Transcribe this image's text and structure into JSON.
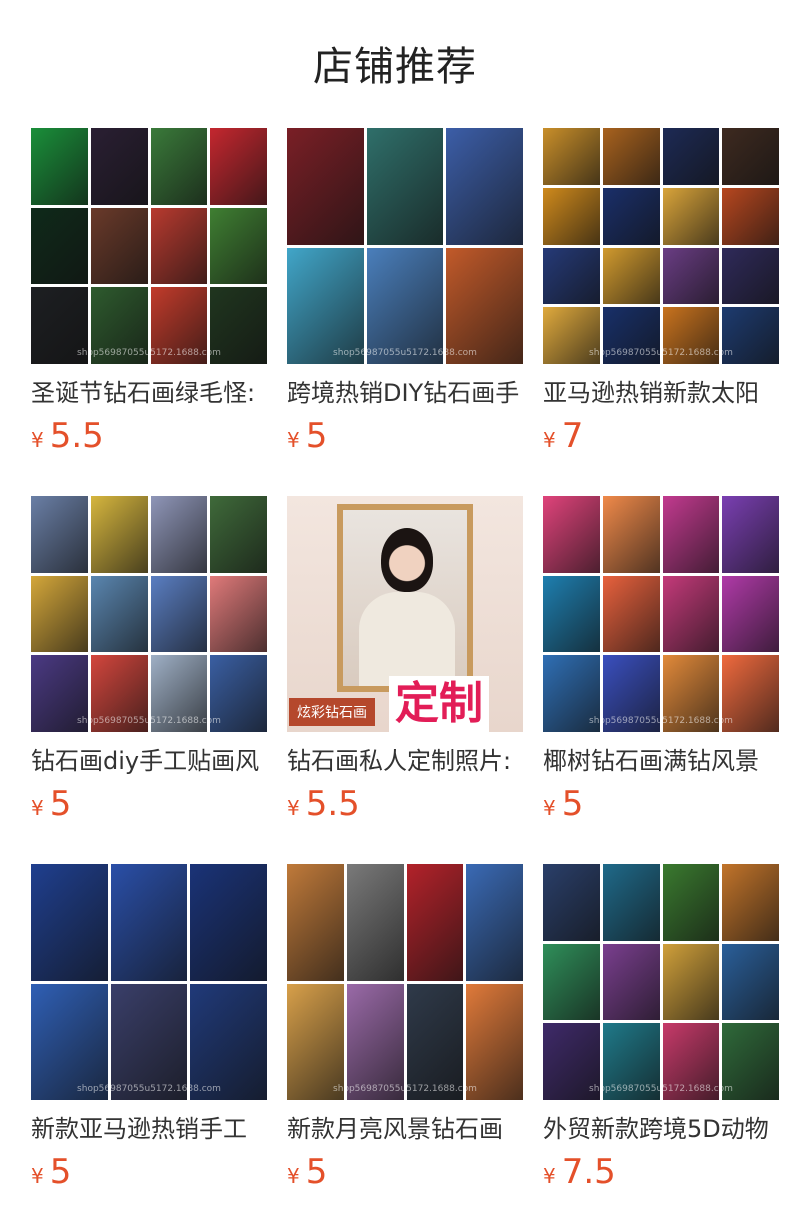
{
  "page": {
    "title": "店铺推荐"
  },
  "currency_symbol": "¥",
  "colors": {
    "price": "#e4502a",
    "title": "#222222"
  },
  "products": [
    {
      "name": "圣诞节钻石画绿毛怪:",
      "price": "5.5",
      "watermark": "shop56987055u5172.1688.com",
      "tiles": [
        "#1a8f3a",
        "#2a1f33",
        "#3a7a3a",
        "#c4272f",
        "#0f2a1a",
        "#6a3a2a",
        "#b83a2f",
        "#3f7f32",
        "#1d1f22",
        "#2e5b2e",
        "#c23b2b",
        "#20361f"
      ]
    },
    {
      "name": "跨境热销DIY钻石画手",
      "price": "5",
      "watermark": "shop56987055u5172.1688.com",
      "tiles": [
        "#7a1f26",
        "#2f6f6a",
        "#3c5ea8",
        "#41a6c9",
        "#4a7fbc",
        "#c25a2a"
      ]
    },
    {
      "name": "亚马逊热销新款太阳",
      "price": "7",
      "watermark": "shop56987055u5172.1688.com",
      "tiles": [
        "#c98f2a",
        "#a8621e",
        "#1d2a55",
        "#3e2a20",
        "#cf8a1c",
        "#1a2f6a",
        "#d9a43a",
        "#b7471f",
        "#253a78",
        "#d19a2e",
        "#6a3d84",
        "#2f2a5a",
        "#e0aa3d",
        "#18306a",
        "#c9731e",
        "#1d3b70"
      ]
    },
    {
      "name": "钻石画diy手工贴画风",
      "price": "5",
      "watermark": "shop56987055u5172.1688.com",
      "tiles": [
        "#6a7fa6",
        "#d6b63e",
        "#8f96b8",
        "#3f6a3a",
        "#d4a73a",
        "#5a86b0",
        "#5a7ec2",
        "#e07a7a",
        "#4b3a84",
        "#d3463d",
        "#9fb0c6",
        "#3a5fa3"
      ]
    },
    {
      "name": "钻石画私人定制照片:",
      "price": "5.5",
      "watermark": "",
      "tag_a": "炫彩钻石画",
      "tag_b": "定制",
      "tiles": []
    },
    {
      "name": "椰树钻石画满钻风景",
      "price": "5",
      "watermark": "shop56987055u5172.1688.com",
      "tiles": [
        "#e0437b",
        "#f08a4a",
        "#c23a8f",
        "#7a3fb2",
        "#1e7fb0",
        "#e8613d",
        "#c43a7a",
        "#b03aa8",
        "#2f6fb5",
        "#3a4fbf",
        "#e28a3a",
        "#f06a3e"
      ]
    },
    {
      "name": "新款亚马逊热销手工",
      "price": "5",
      "watermark": "shop56987055u5172.1688.com",
      "tiles": [
        "#1f3f8f",
        "#2a4fa8",
        "#1a3378",
        "#2f5fb5",
        "#3a3f6a",
        "#203a7a"
      ]
    },
    {
      "name": "新款月亮风景钻石画",
      "price": "5",
      "watermark": "shop56987055u5172.1688.com",
      "tiles": [
        "#c07a3a",
        "#7a7a7a",
        "#b3222a",
        "#3a6ab5",
        "#d8a04a",
        "#9a6aa8",
        "#2f3a4a",
        "#e07a3a"
      ]
    },
    {
      "name": "外贸新款跨境5D动物",
      "price": "7.5",
      "watermark": "shop56987055u5172.1688.com",
      "tiles": [
        "#2a3f6a",
        "#1f6a8a",
        "#3a7a2f",
        "#c2742a",
        "#2f8f5a",
        "#7a3f8f",
        "#d0a03a",
        "#2a5f9a",
        "#3f2a6a",
        "#1f7a8a",
        "#c73a6a",
        "#2f6a3a"
      ]
    }
  ]
}
